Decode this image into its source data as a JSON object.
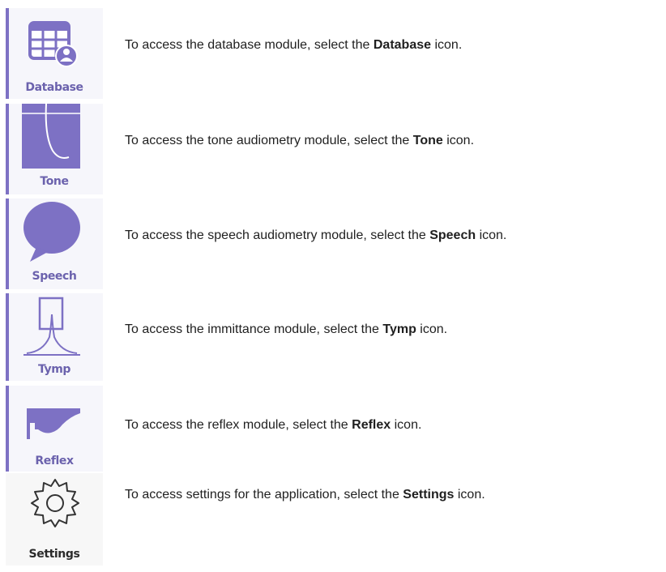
{
  "modules": [
    {
      "icon": "database-table-user-icon",
      "label": "Database",
      "desc_prefix": "To access the database module, select the ",
      "desc_bold": "Database",
      "desc_suffix": " icon."
    },
    {
      "icon": "tone-audiogram-curve-icon",
      "label": "Tone",
      "desc_prefix": "To access the tone audiometry module, select the ",
      "desc_bold": "Tone",
      "desc_suffix": " icon."
    },
    {
      "icon": "speech-bubble-icon",
      "label": "Speech",
      "desc_prefix": "To access the speech audiometry module, select the ",
      "desc_bold": "Speech",
      "desc_suffix": " icon."
    },
    {
      "icon": "tymp-peak-curve-icon",
      "label": "Tymp",
      "desc_prefix": "To access the immittance module, select the ",
      "desc_bold": "Tymp",
      "desc_suffix": " icon."
    },
    {
      "icon": "reflex-curve-icon",
      "label": "Reflex",
      "desc_prefix": "To access the reflex module, select the ",
      "desc_bold": "Reflex",
      "desc_suffix": " icon."
    },
    {
      "icon": "gear-icon",
      "label": "Settings",
      "desc_prefix": "To access settings for the application, select the ",
      "desc_bold": "Settings",
      "desc_suffix": " icon."
    }
  ],
  "colors": {
    "accent": "#7d71c4",
    "label_text": "#6b62ad"
  }
}
